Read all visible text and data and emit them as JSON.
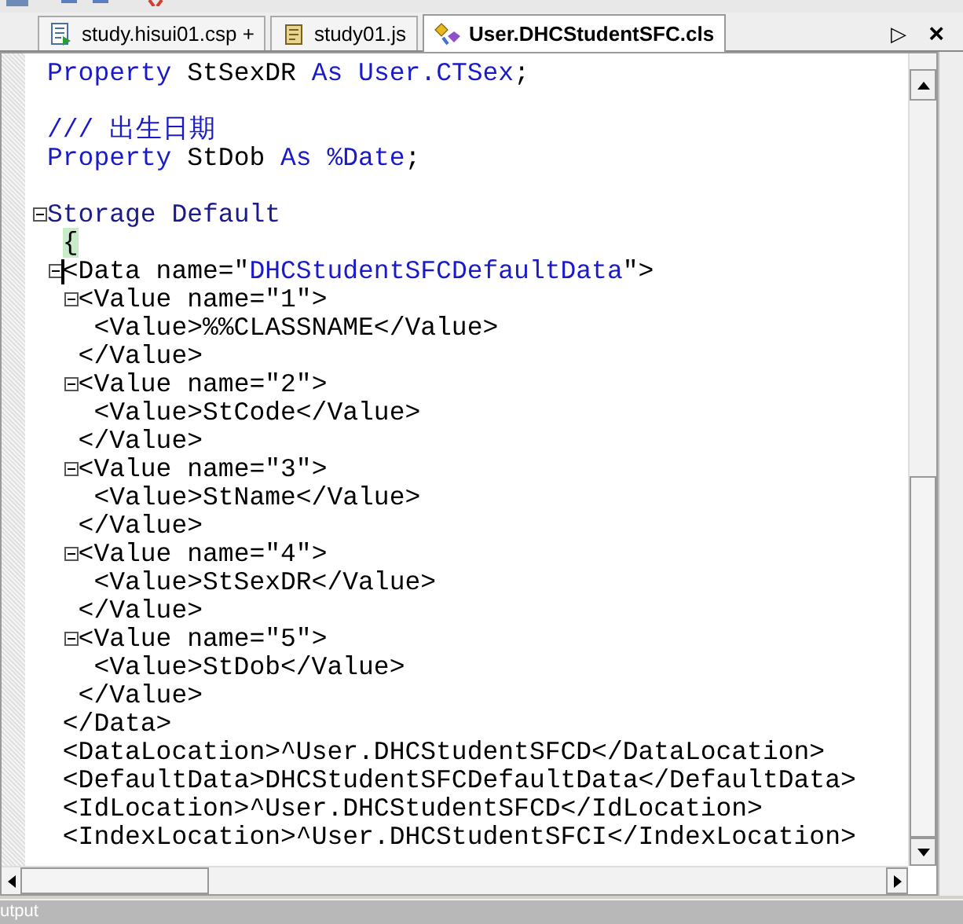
{
  "tabs": [
    {
      "label": "study.hisui01.csp +",
      "kind": "csp",
      "selected": false
    },
    {
      "label": "study01.js",
      "kind": "js",
      "selected": false
    },
    {
      "label": "User.DHCStudentSFC.cls",
      "kind": "cls",
      "selected": true
    }
  ],
  "tab_strip_buttons": [
    {
      "kind": "scroll",
      "label": "▷"
    },
    {
      "kind": "close",
      "label": "×"
    }
  ],
  "code_lines": [
    {
      "segments": [
        {
          "kind": "keyword",
          "text": "Property"
        },
        {
          "kind": "plain",
          "text": " StSexDR "
        },
        {
          "kind": "keyword",
          "text": "As"
        },
        {
          "kind": "keyword",
          "text": " User.CTSex"
        },
        {
          "kind": "plain",
          "text": ";"
        }
      ]
    },
    {
      "kind": "blank"
    },
    {
      "segments": [
        {
          "kind": "comment",
          "text": "/// 出生日期"
        }
      ]
    },
    {
      "segments": [
        {
          "kind": "keyword",
          "text": "Property"
        },
        {
          "kind": "plain",
          "text": " StDob "
        },
        {
          "kind": "keyword",
          "text": "As"
        },
        {
          "kind": "keyword",
          "text": " %Date"
        },
        {
          "kind": "plain",
          "text": ";"
        }
      ]
    },
    {
      "kind": "blank"
    },
    {
      "expanded": true,
      "segments": [
        {
          "kind": "section",
          "text": "Storage Default"
        }
      ],
      "children": [
        {
          "segments": [
            {
              "kind": "plain",
              "text": "{",
              "highlight": true
            }
          ]
        },
        {
          "expanded": true,
          "caret": true,
          "segments": [
            {
              "kind": "plain",
              "text": "<Data name=\""
            },
            {
              "kind": "string",
              "text": "DHCStudentSFCDefaultData"
            },
            {
              "kind": "plain",
              "text": "\">"
            }
          ],
          "children": [
            {
              "expanded": true,
              "segments": [
                {
                  "kind": "plain",
                  "text": "<Value name=\"1\">"
                }
              ],
              "children": [
                {
                  "segments": [
                    {
                      "kind": "plain",
                      "text": "<Value>%%CLASSNAME</Value>"
                    }
                  ]
                }
              ]
            },
            {
              "segments": [
                {
                  "kind": "plain",
                  "text": "</Value>"
                }
              ]
            },
            {
              "expanded": true,
              "segments": [
                {
                  "kind": "plain",
                  "text": "<Value name=\"2\">"
                }
              ],
              "children": [
                {
                  "segments": [
                    {
                      "kind": "plain",
                      "text": "<Value>StCode</Value>"
                    }
                  ]
                }
              ]
            },
            {
              "segments": [
                {
                  "kind": "plain",
                  "text": "</Value>"
                }
              ]
            },
            {
              "expanded": true,
              "segments": [
                {
                  "kind": "plain",
                  "text": "<Value name=\"3\">"
                }
              ],
              "children": [
                {
                  "segments": [
                    {
                      "kind": "plain",
                      "text": "<Value>StName</Value>"
                    }
                  ]
                }
              ]
            },
            {
              "segments": [
                {
                  "kind": "plain",
                  "text": "</Value>"
                }
              ]
            },
            {
              "expanded": true,
              "segments": [
                {
                  "kind": "plain",
                  "text": "<Value name=\"4\">"
                }
              ],
              "children": [
                {
                  "segments": [
                    {
                      "kind": "plain",
                      "text": "<Value>StSexDR</Value>"
                    }
                  ]
                }
              ]
            },
            {
              "segments": [
                {
                  "kind": "plain",
                  "text": "</Value>"
                }
              ]
            },
            {
              "expanded": true,
              "segments": [
                {
                  "kind": "plain",
                  "text": "<Value name=\"5\">"
                }
              ],
              "children": [
                {
                  "segments": [
                    {
                      "kind": "plain",
                      "text": "<Value>StDob</Value>"
                    }
                  ]
                }
              ]
            },
            {
              "segments": [
                {
                  "kind": "plain",
                  "text": "</Value>"
                }
              ]
            }
          ]
        },
        {
          "segments": [
            {
              "kind": "plain",
              "text": "</Data>"
            }
          ]
        },
        {
          "segments": [
            {
              "kind": "plain",
              "text": "<DataLocation>^User.DHCStudentSFCD</DataLocation>"
            }
          ]
        },
        {
          "segments": [
            {
              "kind": "plain",
              "text": "<DefaultData>DHCStudentSFCDefaultData</DefaultData>"
            }
          ]
        },
        {
          "segments": [
            {
              "kind": "plain",
              "text": "<IdLocation>^User.DHCStudentSFCD</IdLocation>"
            }
          ]
        },
        {
          "segments": [
            {
              "kind": "plain",
              "text": "<IndexLocation>^User.DHCStudentSFCI</IndexLocation>"
            }
          ]
        }
      ]
    }
  ],
  "output_panel": {
    "title": "utput"
  }
}
